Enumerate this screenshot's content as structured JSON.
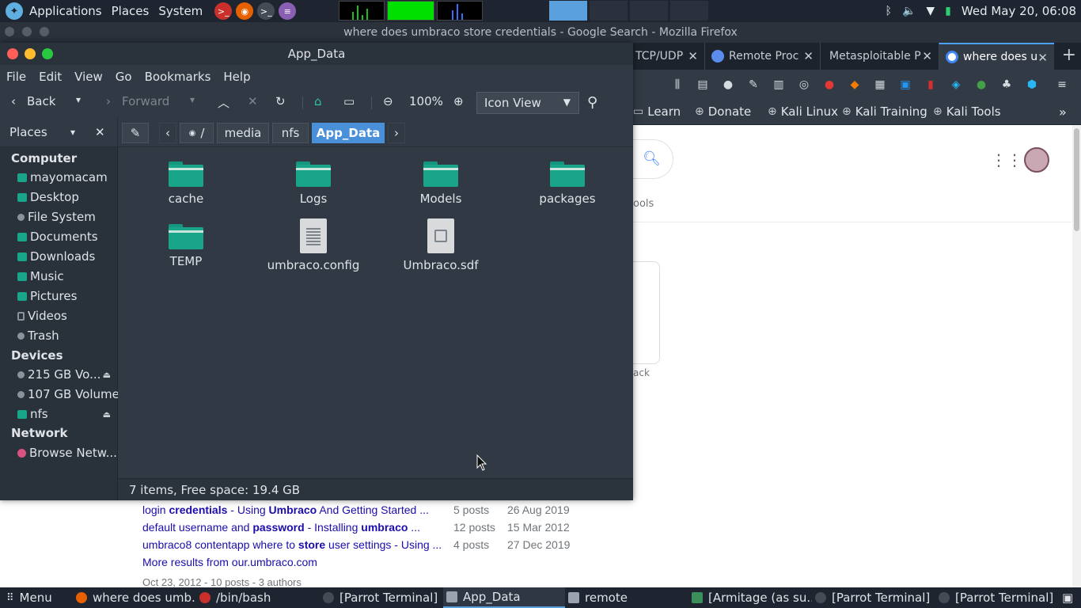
{
  "top_panel": {
    "menus": [
      "Applications",
      "Places",
      "System"
    ],
    "clock": "Wed May 20, 06:08"
  },
  "firefox": {
    "title": "where does umbraco store credentials - Google Search - Mozilla Firefox",
    "tabs": [
      {
        "label": "TCP/UDP"
      },
      {
        "label": "Remote Proc"
      },
      {
        "label": "Metasploitable P"
      },
      {
        "label": "where does u"
      }
    ],
    "bookmarks": [
      "Learn",
      "Donate",
      "Kali Linux",
      "Kali Training",
      "Kali Tools"
    ],
    "tools_fragment": "ools",
    "feedback_fragment": "ack",
    "results": [
      {
        "pre": "login ",
        "b1": "credentials",
        "mid": " - Using ",
        "b2": "Umbraco",
        "post": " And Getting Started ...",
        "posts": "5 posts",
        "date": "26 Aug 2019"
      },
      {
        "pre": "default username and ",
        "b1": "password",
        "mid": " - Installing ",
        "b2": "umbraco",
        "post": " ...",
        "posts": "12 posts",
        "date": "15 Mar 2012"
      },
      {
        "pre": "umbraco8 contentapp where to ",
        "b1": "store",
        "mid": " user settings - Using ...",
        "b2": "",
        "post": "",
        "posts": "4 posts",
        "date": "27 Dec 2019"
      }
    ],
    "more_results": "More results from our.umbraco.com",
    "meta": "Oct 23, 2012 - 10 posts - 3 authors"
  },
  "file_manager": {
    "title": "App_Data",
    "menu": [
      "File",
      "Edit",
      "View",
      "Go",
      "Bookmarks",
      "Help"
    ],
    "toolbar": {
      "back": "Back",
      "forward": "Forward",
      "zoom": "100%",
      "view_mode": "Icon View"
    },
    "sidebar_title": "Places",
    "path": [
      "/",
      "media",
      "nfs",
      "App_Data"
    ],
    "sidebar": {
      "computer_header": "Computer",
      "computer": [
        "mayomacam",
        "Desktop",
        "File System",
        "Documents",
        "Downloads",
        "Music",
        "Pictures",
        "Videos",
        "Trash"
      ],
      "devices_header": "Devices",
      "devices": [
        "215 GB Vo...",
        "107 GB Volume",
        "nfs"
      ],
      "network_header": "Network",
      "network": [
        "Browse Netw..."
      ]
    },
    "files": [
      {
        "name": "cache",
        "type": "folder"
      },
      {
        "name": "Logs",
        "type": "folder"
      },
      {
        "name": "Models",
        "type": "folder"
      },
      {
        "name": "packages",
        "type": "folder"
      },
      {
        "name": "TEMP",
        "type": "folder"
      },
      {
        "name": "umbraco.config",
        "type": "text-file"
      },
      {
        "name": "Umbraco.sdf",
        "type": "media-file"
      }
    ],
    "status": "7 items, Free space: 19.4 GB"
  },
  "taskbar": {
    "menu": "Menu",
    "tasks": [
      "where does umb...",
      "/bin/bash",
      "[Parrot Terminal]",
      "App_Data",
      "remote",
      "[Armitage (as su...",
      "[Parrot Terminal]",
      "[Parrot Terminal]"
    ]
  },
  "colors": {
    "accent": "#4a90d9",
    "folder": "#18a58a",
    "panel_bg": "#1e2530",
    "window_bg": "#313a44"
  }
}
